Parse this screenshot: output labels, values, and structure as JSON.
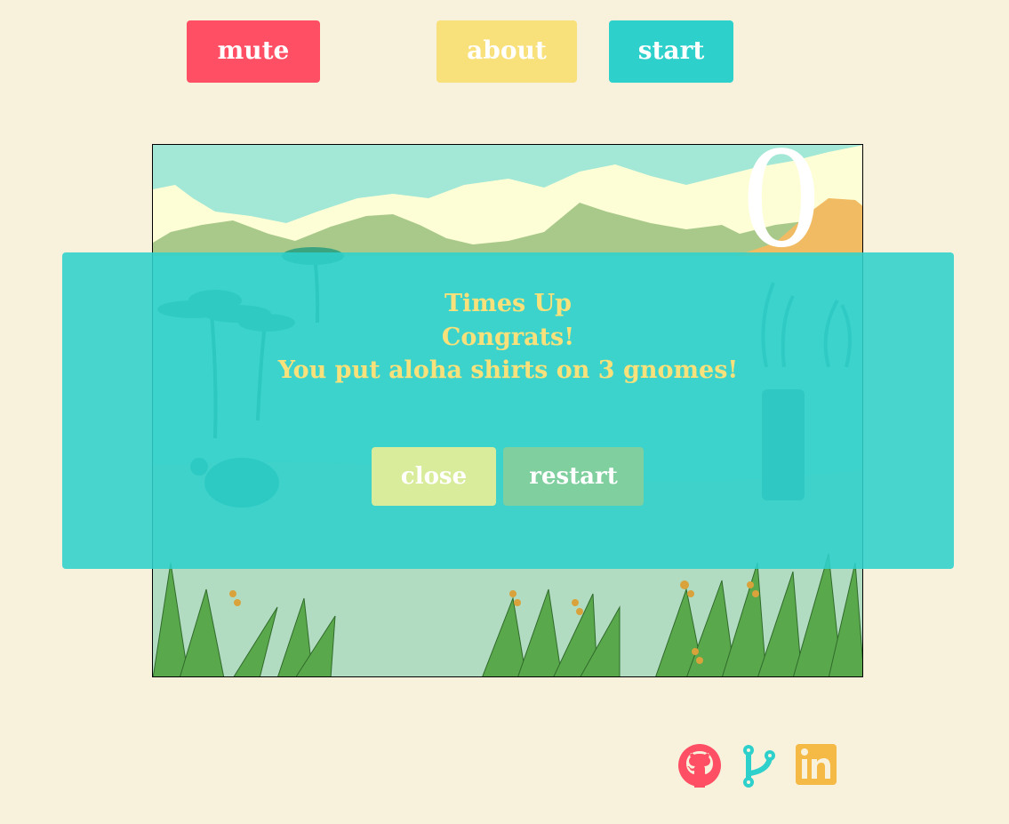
{
  "toolbar": {
    "mute_label": "mute",
    "about_label": "about",
    "start_label": "start"
  },
  "game": {
    "score": "0"
  },
  "modal": {
    "line1": "Times Up",
    "line2": "Congrats!",
    "line3": "You put aloha shirts on 3 gnomes!",
    "close_label": "close",
    "restart_label": "restart"
  },
  "footer": {
    "icons": [
      "github-icon",
      "git-branch-icon",
      "linkedin-icon"
    ]
  },
  "colors": {
    "background": "#f8f2dd",
    "mute": "#ff4f64",
    "about": "#f8e07a",
    "start": "#2ed0cc",
    "modal": "#2ed0cc",
    "close": "#d8ec9b",
    "restart": "#7fcf9f",
    "linkedin": "#f5b945"
  }
}
